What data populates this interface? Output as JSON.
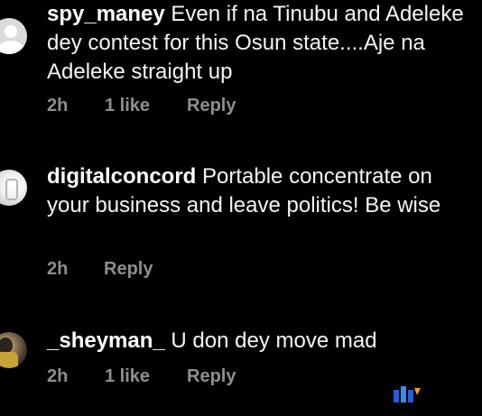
{
  "comments": [
    {
      "username": "spy_maney",
      "text": " Even if na Tinubu and Adeleke dey contest for this Osun state....Aje na Adeleke straight up",
      "time": "2h",
      "likes": "1 like",
      "reply": "Reply"
    },
    {
      "username": "digitalconcord",
      "text": " Portable concentrate on your business and leave politics! Be wise",
      "time": "2h",
      "likes": "",
      "reply": "Reply"
    },
    {
      "username": "_sheyman_",
      "text": " U don dey move mad",
      "time": "2h",
      "likes": "1 like",
      "reply": "Reply"
    }
  ],
  "colors": {
    "background": "#000000",
    "text": "#f5f5f5",
    "meta": "#8e8e8e"
  },
  "icons": {
    "avatar_1": "default-profile-avatar",
    "avatar_2": "profile-photo-avatar",
    "avatar_3": "profile-photo-avatar",
    "watermark": "brand-logo-watermark"
  }
}
